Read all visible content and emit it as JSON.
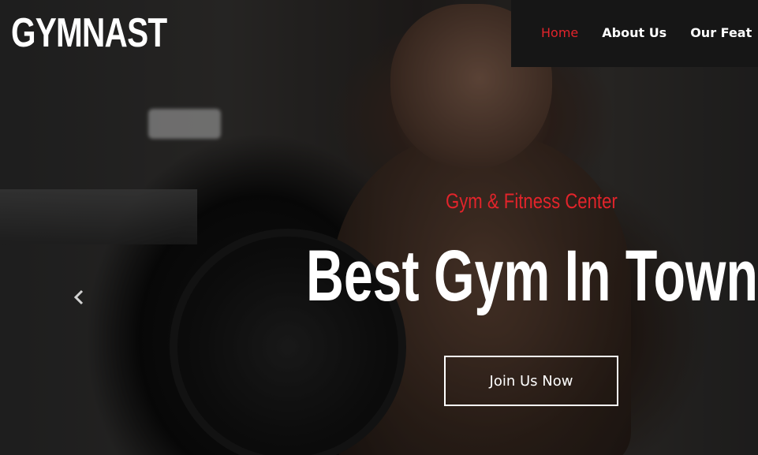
{
  "brand": {
    "logo_text": "GYMNAST"
  },
  "nav": {
    "items": [
      {
        "label": "Home",
        "active": true
      },
      {
        "label": "About Us",
        "active": false
      },
      {
        "label": "Our Feat",
        "active": false
      }
    ]
  },
  "hero": {
    "subtitle": "Gym & Fitness Center",
    "headline": "Best Gym In Town",
    "cta_label": "Join Us Now",
    "prev_icon": "chevron-left-icon"
  },
  "colors": {
    "accent": "#e2242b",
    "nav_bg": "#161616",
    "text": "#ffffff"
  }
}
